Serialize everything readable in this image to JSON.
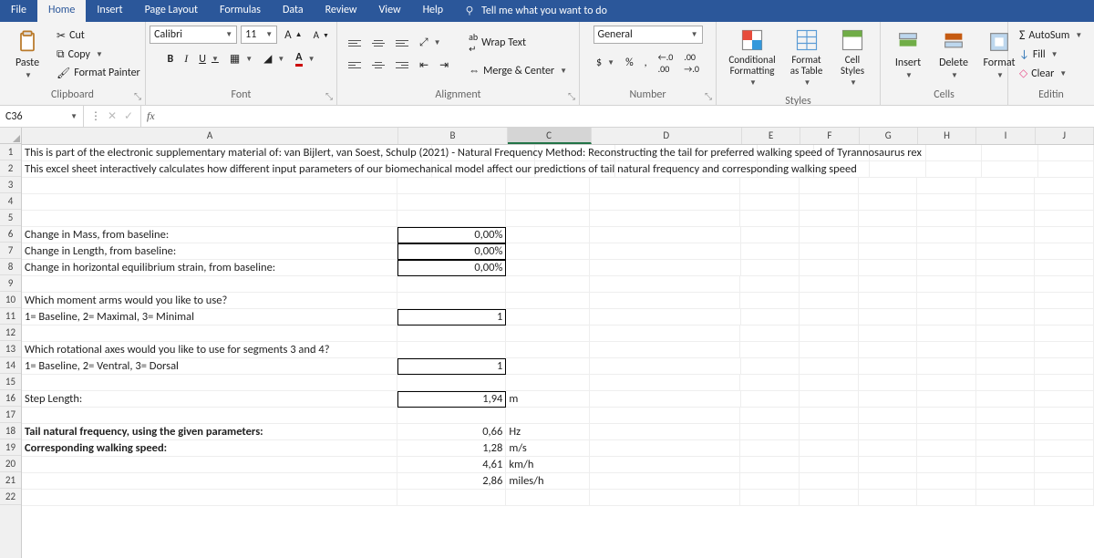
{
  "tabs": [
    "File",
    "Home",
    "Insert",
    "Page Layout",
    "Formulas",
    "Data",
    "Review",
    "View",
    "Help"
  ],
  "active_tab": 1,
  "tell_me": "Tell me what you want to do",
  "ribbon": {
    "clipboard": {
      "label": "Clipboard",
      "paste": "Paste",
      "cut": "Cut",
      "copy": "Copy",
      "painter": "Format Painter"
    },
    "font": {
      "label": "Font",
      "name": "Calibri",
      "size": "11",
      "bold": "B",
      "italic": "I",
      "underline": "U",
      "incA": "A",
      "decA": "A"
    },
    "alignment": {
      "label": "Alignment",
      "wrap": "Wrap Text",
      "merge": "Merge & Center"
    },
    "number": {
      "label": "Number",
      "format": "General"
    },
    "styles": {
      "label": "Styles",
      "cond": "Conditional Formatting",
      "table": "Format as Table",
      "cell": "Cell Styles"
    },
    "cells": {
      "label": "Cells",
      "insert": "Insert",
      "delete": "Delete",
      "format": "Format"
    },
    "editing": {
      "label": "Editin",
      "autosum": "AutoSum",
      "fill": "Fill",
      "clear": "Clear"
    }
  },
  "namebox": "C36",
  "formula": "",
  "col_headers": [
    "A",
    "B",
    "C",
    "D",
    "E",
    "F",
    "G",
    "H",
    "I",
    "J"
  ],
  "col_classes": [
    "colA",
    "colB",
    "colC",
    "colD",
    "colE",
    "colF",
    "colG",
    "colH",
    "colI",
    "colJ"
  ],
  "rows": [
    {
      "n": 1,
      "A": "This is part of the electronic supplementary material of: van Bijlert, van Soest, Schulp (2021) - Natural Frequency Method: Reconstructing the tail for preferred walking speed of Tyrannosaurus rex",
      "long": true
    },
    {
      "n": 2,
      "A": "This excel sheet interactively calculates how different input parameters of our biomechanical model affect our predictions of tail natural frequency and corresponding walking speed",
      "long": true
    },
    {
      "n": 3
    },
    {
      "n": 4
    },
    {
      "n": 5
    },
    {
      "n": 6,
      "A": "Change in Mass, from baseline:",
      "B": "0,00%",
      "input": true
    },
    {
      "n": 7,
      "A": "Change in Length, from baseline:",
      "B": "0,00%",
      "input": true
    },
    {
      "n": 8,
      "A": "Change in horizontal equilibrium strain, from baseline:",
      "B": "0,00%",
      "input": true
    },
    {
      "n": 9
    },
    {
      "n": 10,
      "A": "Which moment arms would you like to use?"
    },
    {
      "n": 11,
      "A": "1= Baseline, 2= Maximal, 3= Minimal",
      "B": "1",
      "input": true
    },
    {
      "n": 12
    },
    {
      "n": 13,
      "A": "Which rotational axes would you like to use for segments 3 and 4?"
    },
    {
      "n": 14,
      "A": "1= Baseline, 2= Ventral, 3= Dorsal",
      "B": "1",
      "input": true
    },
    {
      "n": 15
    },
    {
      "n": 16,
      "A": "Step Length:",
      "B": "1,94",
      "C": "m",
      "input": true
    },
    {
      "n": 17
    },
    {
      "n": 18,
      "A": "Tail natural frequency, using the given parameters:",
      "B": "0,66",
      "C": "Hz",
      "boldA": true,
      "rightB": true
    },
    {
      "n": 19,
      "A": "Corresponding walking speed:",
      "B": "1,28",
      "C": "m/s",
      "boldA": true,
      "rightB": true
    },
    {
      "n": 20,
      "B": "4,61",
      "C": "km/h",
      "rightB": true
    },
    {
      "n": 21,
      "B": "2,86",
      "C": "miles/h",
      "rightB": true
    },
    {
      "n": 22
    }
  ]
}
